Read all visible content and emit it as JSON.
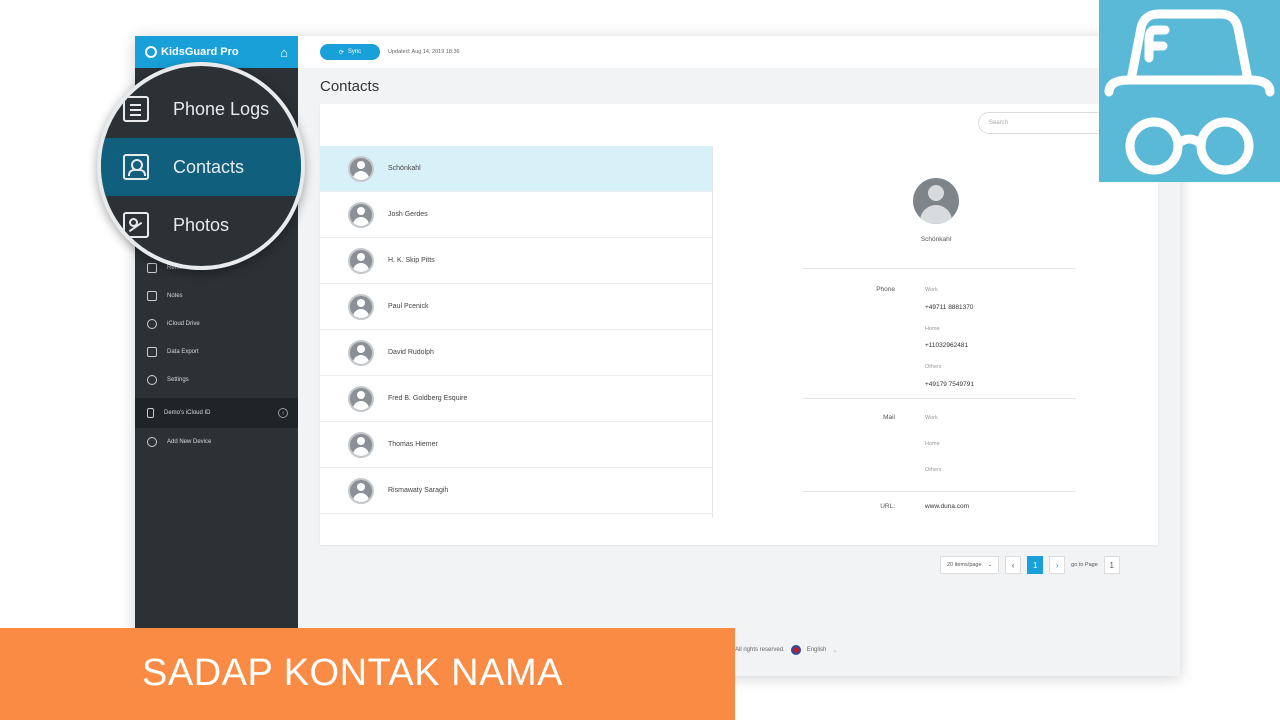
{
  "brand": {
    "name": "KidsGuard Pro"
  },
  "topbar": {
    "sync_label": "Sync",
    "updated": "Updated: Aug 14, 2019 18:36"
  },
  "page_title": "Contacts",
  "search": {
    "placeholder": "Search"
  },
  "sidebar": {
    "items": [
      {
        "label": "Reminders",
        "icon": "reminder-icon"
      },
      {
        "label": "Notes",
        "icon": "notes-icon"
      },
      {
        "label": "iCloud Drive",
        "icon": "cloud-icon"
      },
      {
        "label": "Data Export",
        "icon": "export-icon"
      },
      {
        "label": "Settings",
        "icon": "gear-icon"
      }
    ],
    "device": "Demo's iCloud ID",
    "add_device": "Add New Device"
  },
  "magnifier": {
    "items": [
      {
        "label": "Phone Logs",
        "icon": "phone-logs-icon"
      },
      {
        "label": "Contacts",
        "icon": "contacts-icon",
        "active": true
      },
      {
        "label": "Photos",
        "icon": "photos-icon"
      }
    ]
  },
  "contacts": [
    {
      "name": "Schönkahl"
    },
    {
      "name": "Josh Gerdes"
    },
    {
      "name": "H. K. Skip Pitts"
    },
    {
      "name": "Paul Pcenick"
    },
    {
      "name": "David Rudolph"
    },
    {
      "name": "Fred B. Goldberg Esquire"
    },
    {
      "name": "Thomas Hiemer"
    },
    {
      "name": "Rismawaty Saragih"
    }
  ],
  "detail": {
    "name": "Schönkahl",
    "phone_label": "Phone",
    "work_label": "Work",
    "work_phone": "+49711 8881370",
    "home_label": "Home",
    "home_phone": "+11032962481",
    "others_label": "Others",
    "others_phone": "+49179 7549791",
    "mail_label": "Mail",
    "mail_work": "Work",
    "mail_home": "Home",
    "mail_others": "Others",
    "url_label": "URL:",
    "url": "www.duna.com"
  },
  "pager": {
    "per_page": "20 items/page",
    "current": "1",
    "goto": "go to Page",
    "goto_value": "1"
  },
  "footer": {
    "rights": "All rights reserved.",
    "language": "English"
  },
  "banner": {
    "text": "SADAP KONTAK NAMA"
  },
  "colors": {
    "accent": "#1aa0d8",
    "sidebar": "#2b3135",
    "banner": "#fa8b45",
    "badge": "#5ab9d6"
  }
}
